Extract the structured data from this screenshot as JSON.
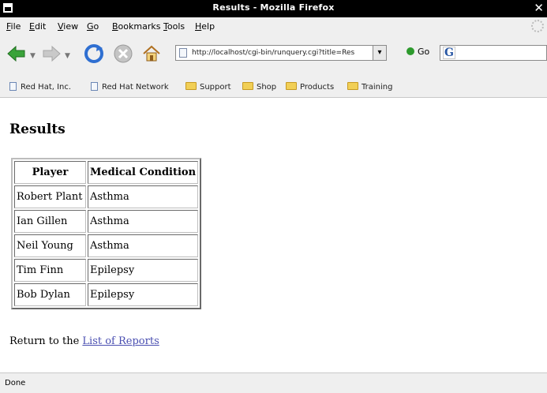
{
  "window": {
    "title": "Results - Mozilla Firefox"
  },
  "menu": [
    {
      "label": "File",
      "u": "F",
      "rest": "ile"
    },
    {
      "label": "Edit",
      "u": "E",
      "rest": "dit"
    },
    {
      "label": "View",
      "u": "V",
      "rest": "iew"
    },
    {
      "label": "Go",
      "u": "G",
      "rest": "o"
    },
    {
      "label": "Bookmarks",
      "u": "B",
      "rest": "ookmarks"
    },
    {
      "label": "Tools",
      "u": "T",
      "rest": "ools"
    },
    {
      "label": "Help",
      "u": "H",
      "rest": "elp"
    }
  ],
  "toolbar": {
    "url": "http://localhost/cgi-bin/runquery.cgi?title=Res",
    "go_label": "Go",
    "icons": [
      "back-arrow-icon",
      "forward-arrow-icon",
      "reload-icon",
      "stop-icon",
      "home-icon"
    ]
  },
  "bookmarks": [
    {
      "label": "Red Hat, Inc.",
      "type": "page"
    },
    {
      "label": "Red Hat Network",
      "type": "page"
    },
    {
      "label": "Support",
      "type": "folder"
    },
    {
      "label": "Shop",
      "type": "folder"
    },
    {
      "label": "Products",
      "type": "folder"
    },
    {
      "label": "Training",
      "type": "folder"
    }
  ],
  "page": {
    "heading": "Results",
    "table": {
      "headers": [
        "Player",
        "Medical Condition"
      ],
      "rows": [
        [
          "Robert Plant",
          "Asthma"
        ],
        [
          "Ian Gillen",
          "Asthma"
        ],
        [
          "Neil Young",
          "Asthma"
        ],
        [
          "Tim Finn",
          "Epilepsy"
        ],
        [
          "Bob Dylan",
          "Epilepsy"
        ]
      ]
    },
    "footer_prefix": "Return to the ",
    "footer_link": "List of Reports"
  },
  "status": {
    "text": "Done"
  },
  "colors": {
    "link": "#4a4fb1",
    "chrome": "#efefef",
    "titlebar": "#000000"
  }
}
